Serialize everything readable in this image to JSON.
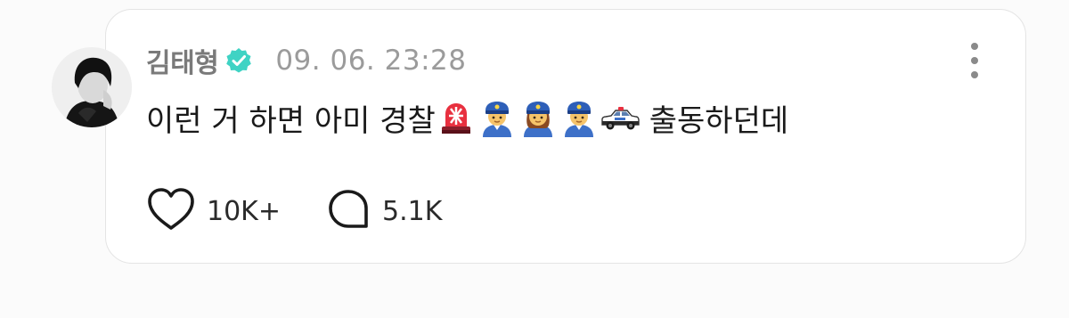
{
  "post": {
    "author": {
      "name": "김태형",
      "verified": true,
      "avatar_icon": "profile-photo"
    },
    "timestamp": "09. 06. 23:28",
    "text_before_emojis": "이런 거 하면 아미 경찰",
    "emojis": [
      "police-light-icon",
      "police-officer-icon",
      "police-officer-woman-icon",
      "police-officer-icon",
      "police-car-icon"
    ],
    "text_after_emojis": "출동하던데",
    "likes": {
      "icon": "heart-icon",
      "count": "10K+"
    },
    "comments": {
      "icon": "comment-bubble-icon",
      "count": "5.1K"
    },
    "more_icon": "more-vertical-icon"
  },
  "colors": {
    "verified_badge": "#3fd3c4",
    "username": "#7a7a7a",
    "timestamp": "#9b9b9b",
    "text": "#1a1a1a"
  }
}
